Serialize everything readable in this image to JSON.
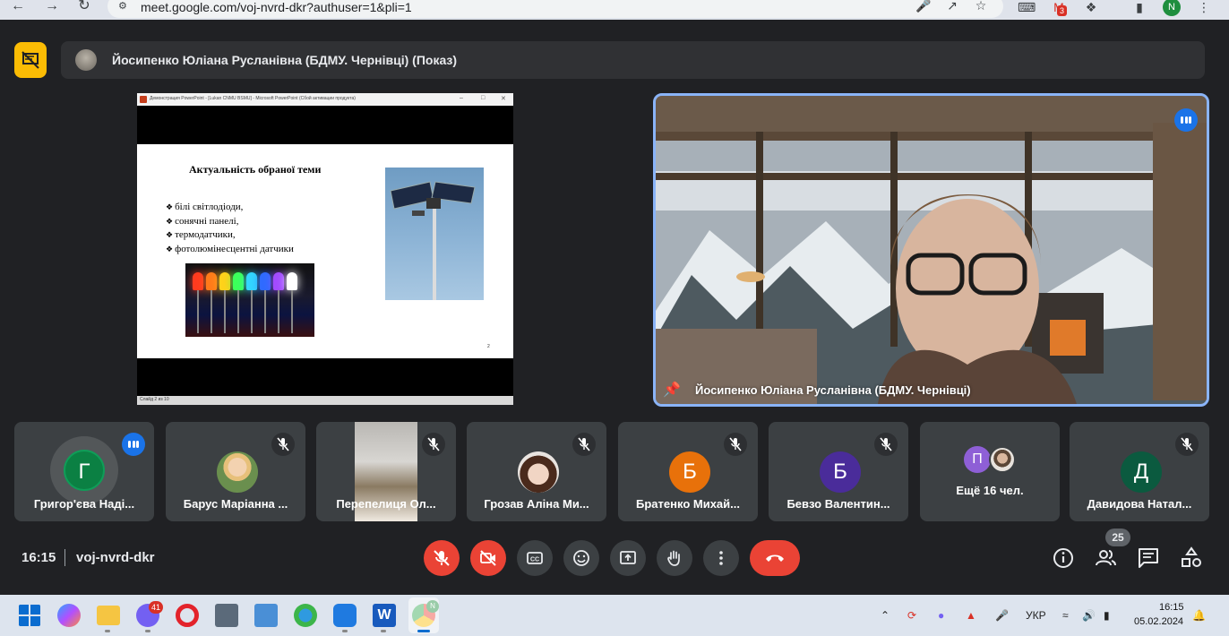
{
  "browser": {
    "url": "meet.google.com/voj-nvrd-dkr?authuser=1&pli=1",
    "gmail_badge": "3",
    "profile_initial": "N"
  },
  "presenter_bar": {
    "name": "Йосипенко Юліана Русланівна (БДМУ. Чернівці) (Показ)"
  },
  "slide": {
    "window_title": "Демонстрация PowerPoint - [Lukan CNMU BSMU] - Microsoft PowerPoint (Сбой активации продукта)",
    "heading": "Актуальність обраної теми",
    "bullets": [
      "білі світлодіоди,",
      "сонячні панелі,",
      "термодатчики,",
      "фотолюмінесцентні датчики"
    ],
    "status": "Слайд 2 из 10",
    "slide_number": "2"
  },
  "speaker": {
    "name": "Йосипенко Юліана Русланівна (БДМУ. Чернівці)"
  },
  "participants": [
    {
      "name": "Григор'єва Наді...",
      "initial": "Г",
      "color": "#0b8043",
      "speaking": true
    },
    {
      "name": "Барус Маріанна ...",
      "initial": "",
      "color": "#7a8a5a"
    },
    {
      "name": "Перепелиця Ол...",
      "initial": "",
      "color": "#8a7f6e"
    },
    {
      "name": "Грозав Аліна Ми...",
      "initial": "",
      "color": "#6b5143"
    },
    {
      "name": "Братенко Михай...",
      "initial": "Б",
      "color": "#e8710a"
    },
    {
      "name": "Бевзо Валентин...",
      "initial": "Б",
      "color": "#4a2c9a"
    },
    {
      "name": "Ещё 16 чел.",
      "initial": "П",
      "color": "#8e5fd6"
    },
    {
      "name": "Давидова Натал...",
      "initial": "Д",
      "color": "#0b5a3f"
    }
  ],
  "meeting": {
    "time": "16:15",
    "code": "voj-nvrd-dkr",
    "participant_count": "25"
  },
  "taskbar": {
    "viber_badge": "41",
    "chrome_badge": "N",
    "language": "УКР",
    "time": "16:15",
    "date": "05.02.2024"
  }
}
